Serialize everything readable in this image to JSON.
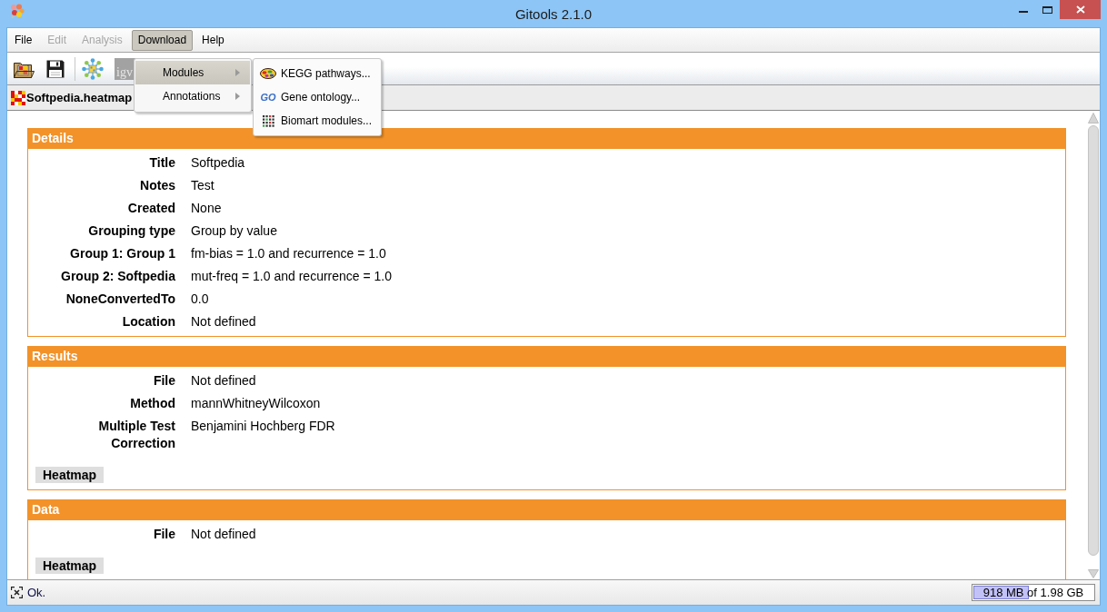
{
  "window": {
    "title": "Gitools 2.1.0"
  },
  "menu_bar": [
    {
      "label": "File",
      "disabled": false,
      "selected": false
    },
    {
      "label": "Edit",
      "disabled": true,
      "selected": false
    },
    {
      "label": "Analysis",
      "disabled": true,
      "selected": false
    },
    {
      "label": "Download",
      "disabled": false,
      "selected": true
    },
    {
      "label": "Help",
      "disabled": false,
      "selected": false
    }
  ],
  "toolbar": {
    "groups": [
      [
        {
          "kind": "open",
          "disabled": false
        },
        {
          "kind": "save",
          "disabled": false
        }
      ],
      [
        {
          "kind": "network",
          "disabled": false
        },
        {
          "kind": "igv",
          "label": "igv",
          "disabled": true
        }
      ]
    ]
  },
  "tabs": [
    {
      "label": "Softpedia.heatmap",
      "selected": true
    }
  ],
  "download_menu": {
    "items": [
      {
        "label": "Modules",
        "selected": true,
        "submenu": true
      },
      {
        "label": "Annotations",
        "selected": false,
        "submenu": true
      }
    ]
  },
  "modules_submenu": {
    "items": [
      {
        "kind": "kegg",
        "label": "KEGG pathways..."
      },
      {
        "kind": "go",
        "badge": "GO",
        "label": "Gene ontology..."
      },
      {
        "kind": "biomart",
        "label": "Biomart modules..."
      }
    ]
  },
  "sections": [
    {
      "title": "Details",
      "rows": [
        {
          "label": "Title",
          "value": "Softpedia"
        },
        {
          "label": "Notes",
          "value": "Test"
        },
        {
          "label": "Created",
          "value": "None"
        },
        {
          "label": "Grouping type",
          "value": "Group by value"
        },
        {
          "label": "Group 1: Group 1",
          "value": "fm-bias = 1.0 and recurrence = 1.0"
        },
        {
          "label": "Group 2: Softpedia",
          "value": "mut-freq = 1.0 and recurrence = 1.0"
        },
        {
          "label": "NoneConvertedTo",
          "value": "0.0"
        },
        {
          "label": "Location",
          "value": "Not defined"
        }
      ]
    },
    {
      "title": "Results",
      "rows": [
        {
          "label": "File",
          "value": "Not defined"
        },
        {
          "label": "Method",
          "value": "mannWhitneyWilcoxon"
        },
        {
          "label": "Multiple Test Correction",
          "value": "Benjamini Hochberg FDR"
        }
      ],
      "buttons": [
        "Heatmap"
      ]
    },
    {
      "title": "Data",
      "rows": [
        {
          "label": "File",
          "value": "Not defined"
        }
      ],
      "buttons": [
        "Heatmap"
      ]
    }
  ],
  "status_bar": {
    "message": "Ok.",
    "memory": {
      "text": "918 MB of 1.98 GB",
      "level": 0.46
    }
  }
}
